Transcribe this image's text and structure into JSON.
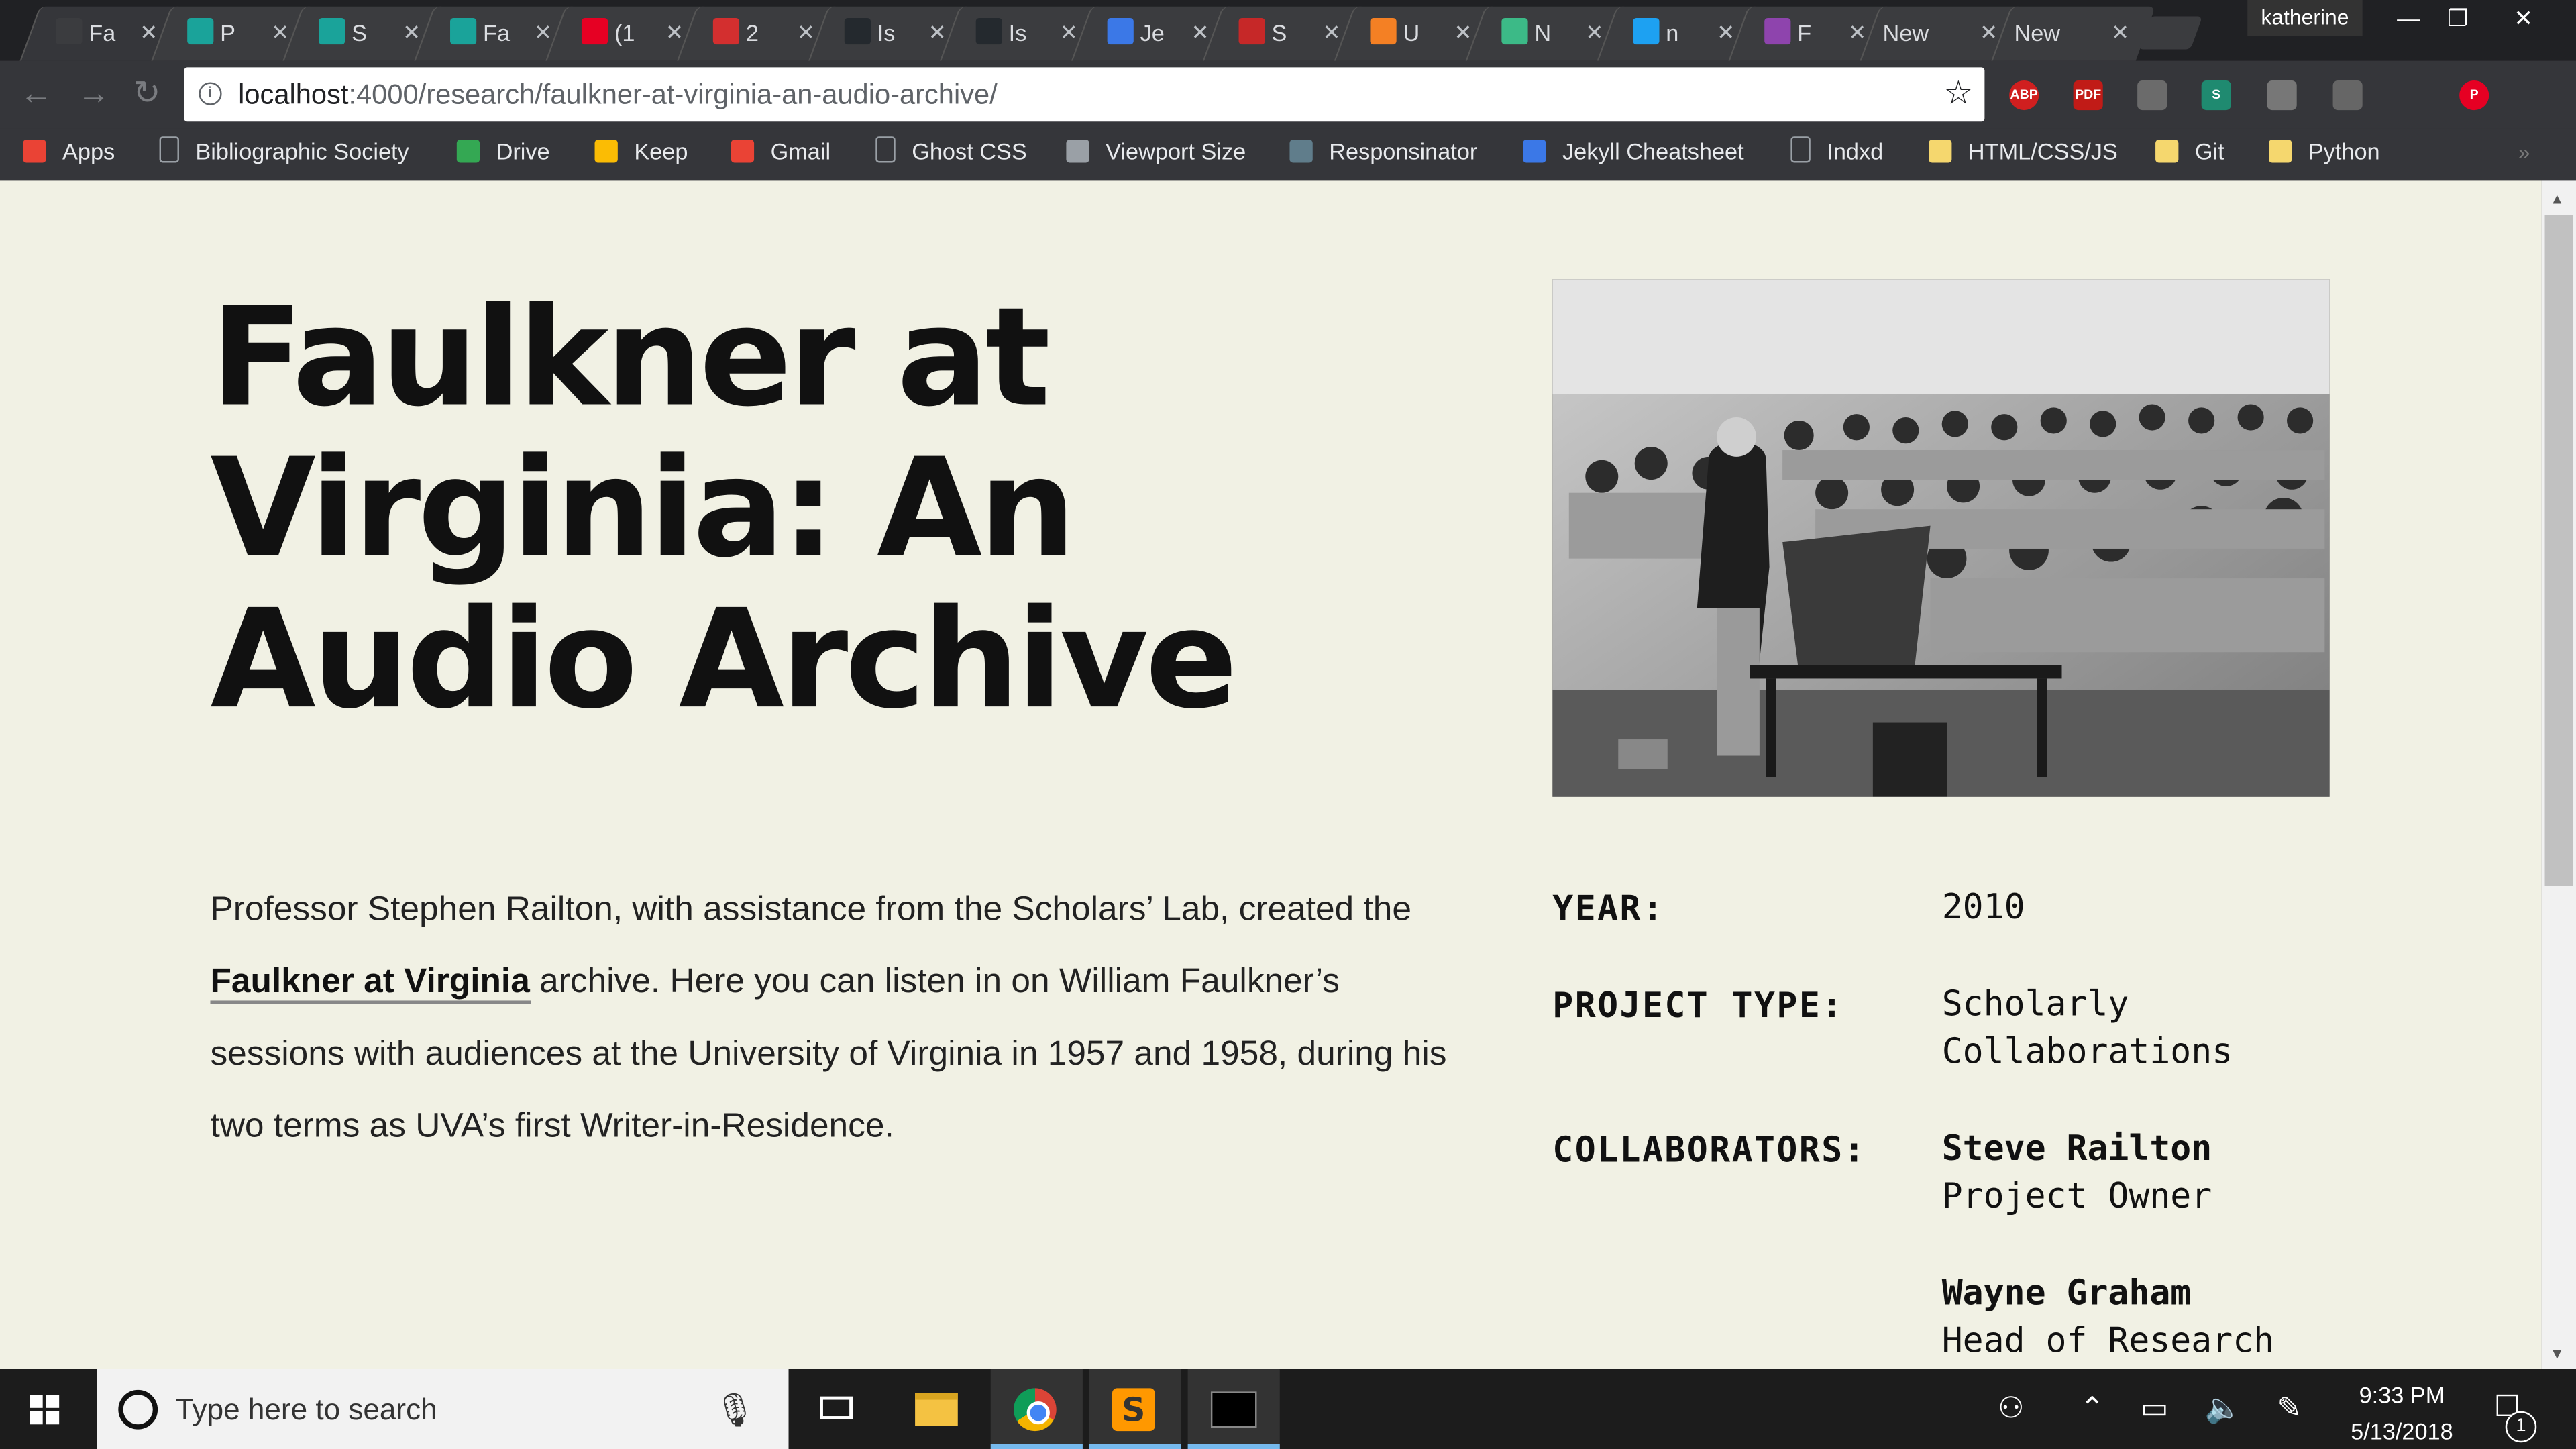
{
  "browser": {
    "tabs": [
      {
        "title": "Fa",
        "icon": "doc-icon",
        "color": "#3b3c3f",
        "active": true
      },
      {
        "title": "P",
        "icon": "teal-square-icon",
        "color": "#1aa39a"
      },
      {
        "title": "S",
        "icon": "teal-square-icon",
        "color": "#1aa39a"
      },
      {
        "title": "Fa",
        "icon": "teal-square-icon",
        "color": "#1aa39a"
      },
      {
        "title": "(1",
        "icon": "pinterest-icon",
        "color": "#e60023"
      },
      {
        "title": "2",
        "icon": "w-logo-icon",
        "color": "#d32f2f"
      },
      {
        "title": "Is",
        "icon": "github-icon",
        "color": "#24292e"
      },
      {
        "title": "Is",
        "icon": "github-icon",
        "color": "#24292e"
      },
      {
        "title": "Je",
        "icon": "eye-icon",
        "color": "#3b78e7"
      },
      {
        "title": "S",
        "icon": "pencil-icon",
        "color": "#c62828"
      },
      {
        "title": "U",
        "icon": "stackoverflow-icon",
        "color": "#f48024"
      },
      {
        "title": "N",
        "icon": "green-square-icon",
        "color": "#3cba87"
      },
      {
        "title": "n",
        "icon": "blue-bird-icon",
        "color": "#1da1f2"
      },
      {
        "title": "F",
        "icon": "diamond-icon",
        "color": "#8e44ad"
      },
      {
        "title": "New",
        "icon": "",
        "color": ""
      },
      {
        "title": "New",
        "icon": "",
        "color": ""
      }
    ],
    "profile_name": "katherine",
    "url_host": "localhost",
    "url_rest": ":4000/research/faulkner-at-virginia-an-audio-archive/",
    "extensions": [
      {
        "name": "adblock-icon",
        "label": "ABP",
        "color": "#d01f1f"
      },
      {
        "name": "pdf-icon",
        "label": "PDF",
        "color": "#c11b17"
      },
      {
        "name": "magnifier-icon",
        "label": "",
        "color": "#6b6b6b"
      },
      {
        "name": "scrivener-icon",
        "label": "S",
        "color": "#1f8a70"
      },
      {
        "name": "bulb-icon",
        "label": "",
        "color": "#777777"
      },
      {
        "name": "square-icon",
        "label": "",
        "color": "#666666"
      },
      {
        "name": "pinterest-icon",
        "label": "P",
        "color": "#e60023"
      }
    ],
    "bookmarks": [
      {
        "label": "Apps",
        "icon": "apps-grid-icon",
        "color": "#ea4335"
      },
      {
        "label": "Bibliographic Society",
        "icon": "page-icon",
        "color": "#5f6368"
      },
      {
        "label": "Drive",
        "icon": "drive-icon",
        "color": "#34a853"
      },
      {
        "label": "Keep",
        "icon": "keep-icon",
        "color": "#fbbc04"
      },
      {
        "label": "Gmail",
        "icon": "gmail-icon",
        "color": "#ea4335"
      },
      {
        "label": "Ghost CSS",
        "icon": "page-icon",
        "color": "#5f6368"
      },
      {
        "label": "Viewport Size",
        "icon": "dots-icon",
        "color": "#9aa0a6"
      },
      {
        "label": "Responsinator",
        "icon": "r-icon",
        "color": "#607d8b"
      },
      {
        "label": "Jekyll Cheatsheet",
        "icon": "eye-icon",
        "color": "#3b78e7"
      },
      {
        "label": "Indxd",
        "icon": "page-icon",
        "color": "#5f6368"
      },
      {
        "label": "HTML/CSS/JS",
        "icon": "folder-icon",
        "color": "#f5d76e"
      },
      {
        "label": "Git",
        "icon": "folder-icon",
        "color": "#f5d76e"
      },
      {
        "label": "Python",
        "icon": "folder-icon",
        "color": "#f5d76e"
      }
    ]
  },
  "page": {
    "title": "Faulkner at Virginia: An Audio Archive",
    "intro_before": "Professor Stephen Railton, with assistance from the Scholars’ Lab, created the ",
    "intro_link": "Faulkner at Virginia",
    "intro_after": " archive. Here you can listen in on William Faulkner’s sessions with audiences at the University of Virginia in 1957 and 1958, during his two terms as UVA’s first Writer-in-Residence.",
    "meta": {
      "year_label": "YEAR:",
      "year_value": "2010",
      "type_label": "PROJECT TYPE:",
      "type_value_1": "Scholarly",
      "type_value_2": "Collaborations",
      "collab_label": "COLLABORATORS:",
      "collaborators": [
        {
          "name": "Steve Railton",
          "role": "Project Owner"
        },
        {
          "name": "Wayne Graham",
          "role": "Head of Research"
        }
      ]
    },
    "background": "#f1f1e4"
  },
  "taskbar": {
    "search_placeholder": "Type here to search",
    "time": "9:33 PM",
    "date": "5/13/2018",
    "notification_count": "1"
  }
}
